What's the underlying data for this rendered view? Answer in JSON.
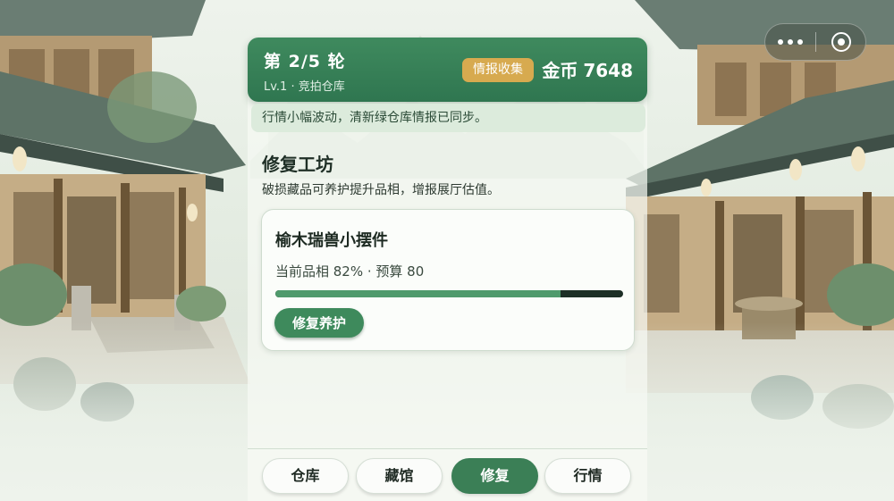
{
  "header": {
    "round_title": "第 2/5 轮",
    "round_sub": "Lv.1 · 竞拍仓库",
    "intel_badge": "情报收集",
    "coins_label": "金币",
    "coins_value": "7648"
  },
  "notice": "行情小幅波动，清新绿仓库情报已同步。",
  "section": {
    "title": "修复工坊",
    "desc": "破损藏品可养护提升品相，增报展厅估值。"
  },
  "item": {
    "name": "榆木瑞兽小摆件",
    "stats": "当前品相 82% · 预算 80",
    "condition_fraction": 0.82,
    "action_label": "修复养护"
  },
  "nav": {
    "tabs": [
      {
        "label": "仓库",
        "active": false
      },
      {
        "label": "藏馆",
        "active": false
      },
      {
        "label": "修复",
        "active": true
      },
      {
        "label": "行情",
        "active": false
      }
    ]
  },
  "capsule": {
    "more_icon": "more-dots-icon",
    "close_icon": "close-circle-icon"
  },
  "colors": {
    "header_green": "#3f8a5e",
    "badge_gold": "#d7aa4f",
    "accent_green": "#3b7f56"
  }
}
